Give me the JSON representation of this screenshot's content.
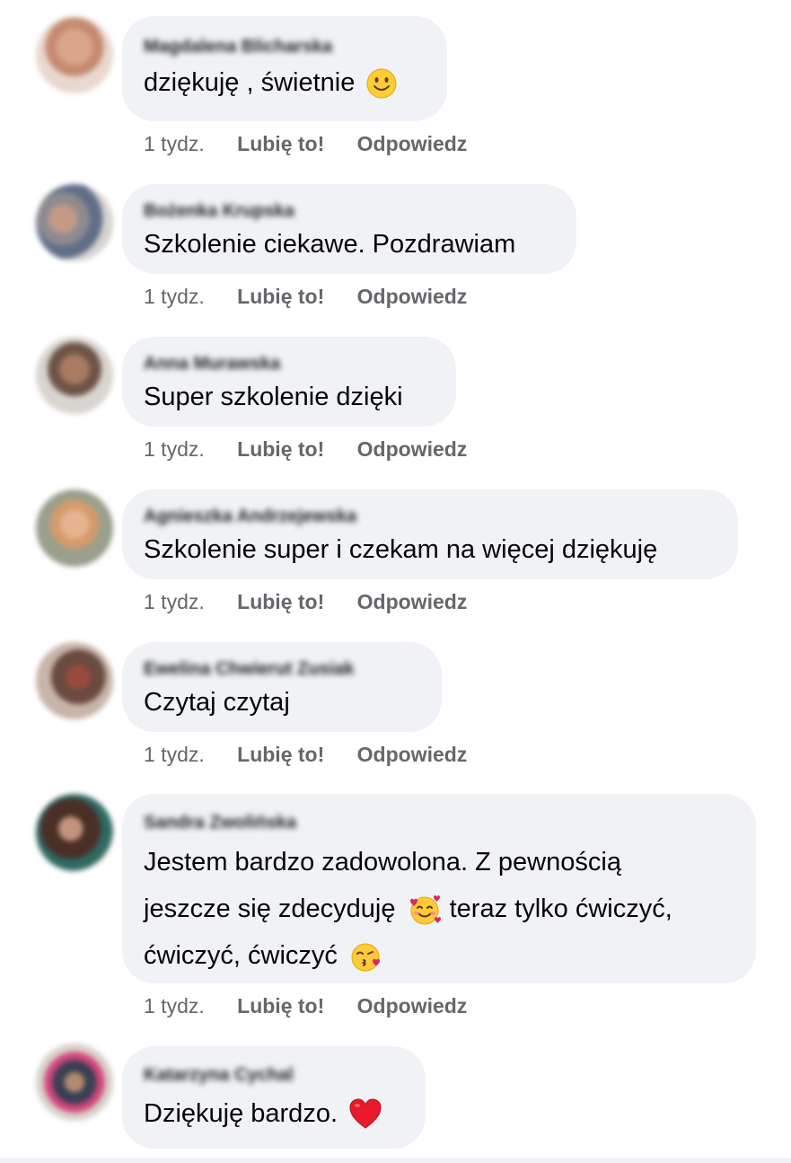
{
  "comments": [
    {
      "author": "Magdalena Blicharska",
      "text": "dziękuję , świetnie",
      "emoji": "slightly-smiling-face-icon",
      "time": "1 tydz.",
      "like": "Lubię to!",
      "reply": "Odpowiedz"
    },
    {
      "author": "Bożenka Krupska",
      "text": "Szkolenie ciekawe. Pozdrawiam",
      "time": "1 tydz.",
      "like": "Lubię to!",
      "reply": "Odpowiedz"
    },
    {
      "author": "Anna Murawska",
      "text": "Super szkolenie dzięki",
      "time": "1 tydz.",
      "like": "Lubię to!",
      "reply": "Odpowiedz"
    },
    {
      "author": "Agnieszka Andrzejewska",
      "text": "Szkolenie super i czekam na więcej dziękuję",
      "time": "1 tydz.",
      "like": "Lubię to!",
      "reply": "Odpowiedz"
    },
    {
      "author": "Ewelina Chwierut Zusiak",
      "text": "Czytaj czytaj",
      "time": "1 tydz.",
      "like": "Lubię to!",
      "reply": "Odpowiedz"
    },
    {
      "author": "Sandra Zwolińska",
      "text_line1": "Jestem bardzo zadowolona. Z pewnością",
      "text_line2a": "jeszcze się zdecyduję",
      "text_line2b": "teraz tylko ćwiczyć,",
      "text_line3": "ćwiczyć, ćwiczyć",
      "emoji_a": "smiling-face-with-hearts-icon",
      "emoji_b": "face-blowing-kiss-icon",
      "time": "1 tydz.",
      "like": "Lubię to!",
      "reply": "Odpowiedz"
    },
    {
      "author": "Katarzyna Cychal",
      "text": "Dziękuję bardzo.",
      "emoji": "red-heart-icon",
      "time": "",
      "like": "",
      "reply": ""
    }
  ],
  "colors": {
    "bubble": "#f0f2f5",
    "meta_text": "#65676b",
    "body_text": "#050505"
  }
}
